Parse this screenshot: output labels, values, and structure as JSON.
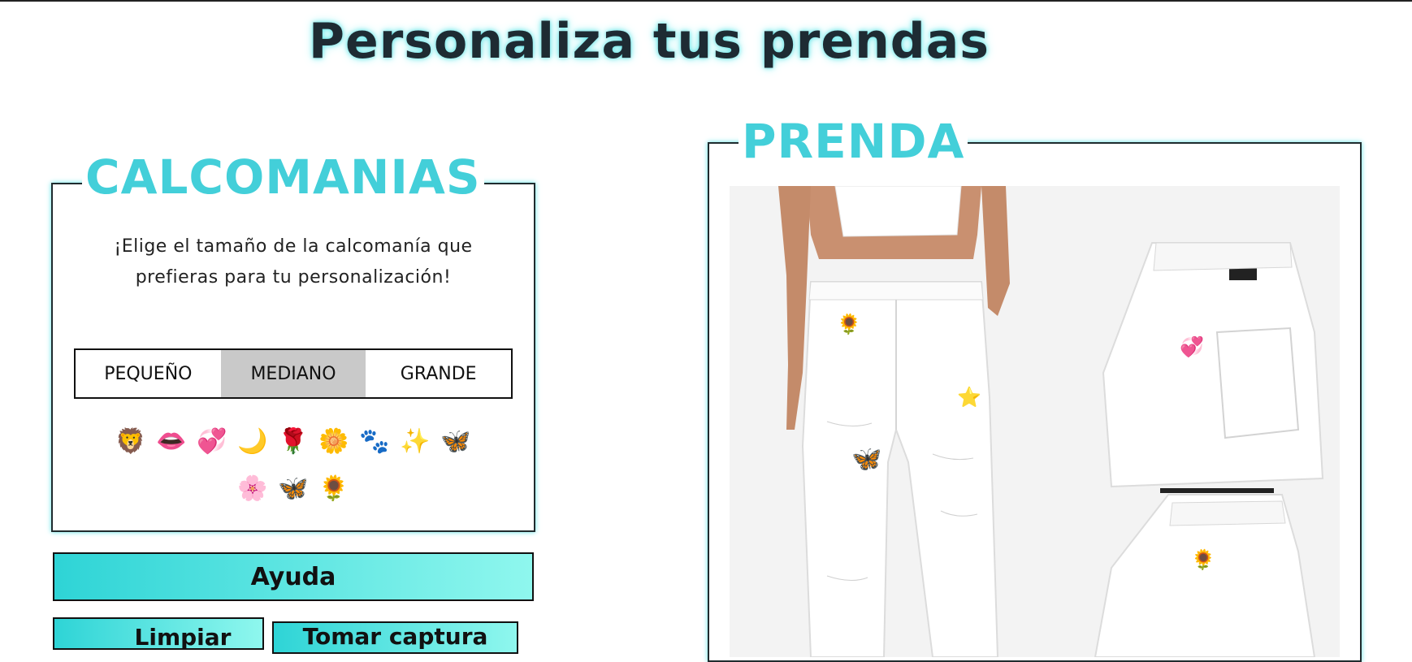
{
  "page": {
    "title": "Personaliza tus prendas"
  },
  "stickers_panel": {
    "legend": "CALCOMANIAS",
    "instructions": "¡Elige el tamaño de la calcomanía que prefieras para tu personalización!",
    "sizes": [
      {
        "label": "PEQUEÑO",
        "active": false
      },
      {
        "label": "MEDIANO",
        "active": true
      },
      {
        "label": "GRANDE",
        "active": false
      }
    ],
    "stickers": [
      {
        "icon": "lion-icon",
        "glyph": "🦁"
      },
      {
        "icon": "lips-icon",
        "glyph": "👄"
      },
      {
        "icon": "heart-icon",
        "glyph": "💞"
      },
      {
        "icon": "moon-icon",
        "glyph": "🌙"
      },
      {
        "icon": "rose-icon",
        "glyph": "🌹"
      },
      {
        "icon": "daisy-icon",
        "glyph": "🌼"
      },
      {
        "icon": "paw-icon",
        "glyph": "🐾"
      },
      {
        "icon": "star-icon",
        "glyph": "✨"
      },
      {
        "icon": "butterfly-icon",
        "glyph": "🦋"
      },
      {
        "icon": "cherry-blossom-icon",
        "glyph": "🌸"
      },
      {
        "icon": "pink-butterfly-icon",
        "glyph": "🦋"
      },
      {
        "icon": "sunflower-icon",
        "glyph": "🌻"
      }
    ]
  },
  "buttons": {
    "help": "Ayuda",
    "clear": "Limpiar",
    "capture": "Tomar captura"
  },
  "garment_panel": {
    "legend": "PRENDA",
    "image_alt": "white ripped jeans with stickers applied"
  },
  "colors": {
    "accent": "#43cfd9",
    "button_gradient_start": "#2ed4d6",
    "button_gradient_end": "#8ff7ee",
    "active_size_bg": "#c9c9c9"
  }
}
